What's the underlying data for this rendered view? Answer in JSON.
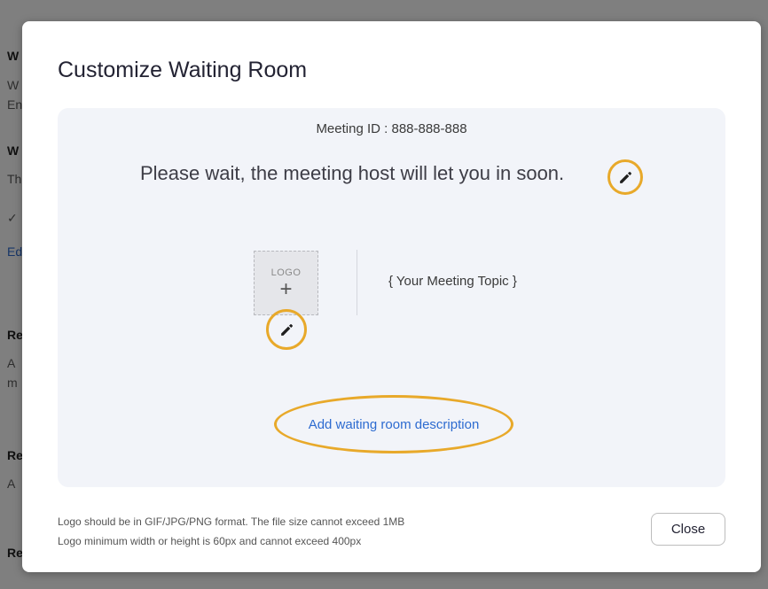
{
  "background": {
    "fragments": [
      "W",
      "W",
      "En",
      "W",
      "Th",
      "✓",
      "Ed",
      "Re",
      "A",
      "m",
      "Re",
      "A",
      "Re"
    ]
  },
  "modal": {
    "title": "Customize Waiting Room",
    "preview": {
      "meeting_id": "Meeting ID : 888-888-888",
      "wait_message": "Please wait, the meeting host will let you in soon.",
      "logo_label": "LOGO",
      "logo_plus": "+",
      "meeting_topic": "{ Your Meeting Topic }",
      "description_link": "Add waiting room description"
    },
    "footer": {
      "note_1": "Logo should be in GIF/JPG/PNG format. The file size cannot exceed 1MB",
      "note_2": "Logo minimum width or height is 60px and cannot exceed 400px",
      "close_label": "Close"
    }
  },
  "colors": {
    "highlight_ring": "#e8a92a",
    "link": "#2d6bd0",
    "preview_bg": "#f2f4f9"
  },
  "icons": {
    "edit_message": "pencil-icon",
    "edit_logo": "pencil-icon"
  }
}
